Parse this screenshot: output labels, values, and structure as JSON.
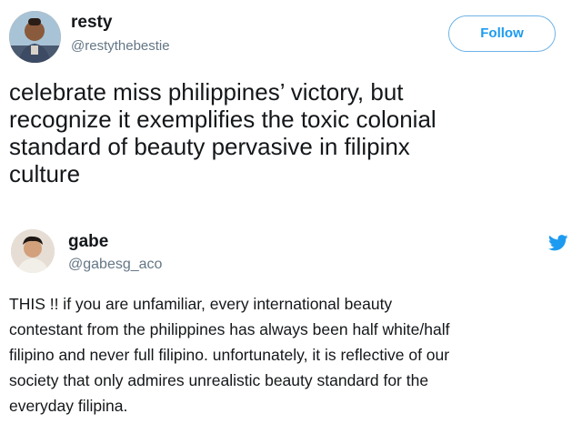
{
  "main_tweet": {
    "name": "resty",
    "handle": "@restythebestie",
    "follow_label": "Follow",
    "text": "celebrate miss philippines’ victory, but\nrecognize it exemplifies the toxic colonial\nstandard of beauty pervasive in filipinx\nculture",
    "avatar": "user-avatar"
  },
  "quoted_tweet": {
    "name": "gabe",
    "handle": "@gabesg_aco",
    "icon": "twitter-bird-icon",
    "text": "THIS !! if you are unfamiliar, every international beauty\ncontestant from the philippines has always been half white/half\nfilipino and never full filipino. unfortunately, it is reflective of our\nsociety that only admires unrealistic beauty standard for the\neveryday filipina.",
    "avatar": "user-avatar"
  },
  "colors": {
    "text": "#14171a",
    "secondary": "#657786",
    "accent": "#1d9bf0"
  }
}
